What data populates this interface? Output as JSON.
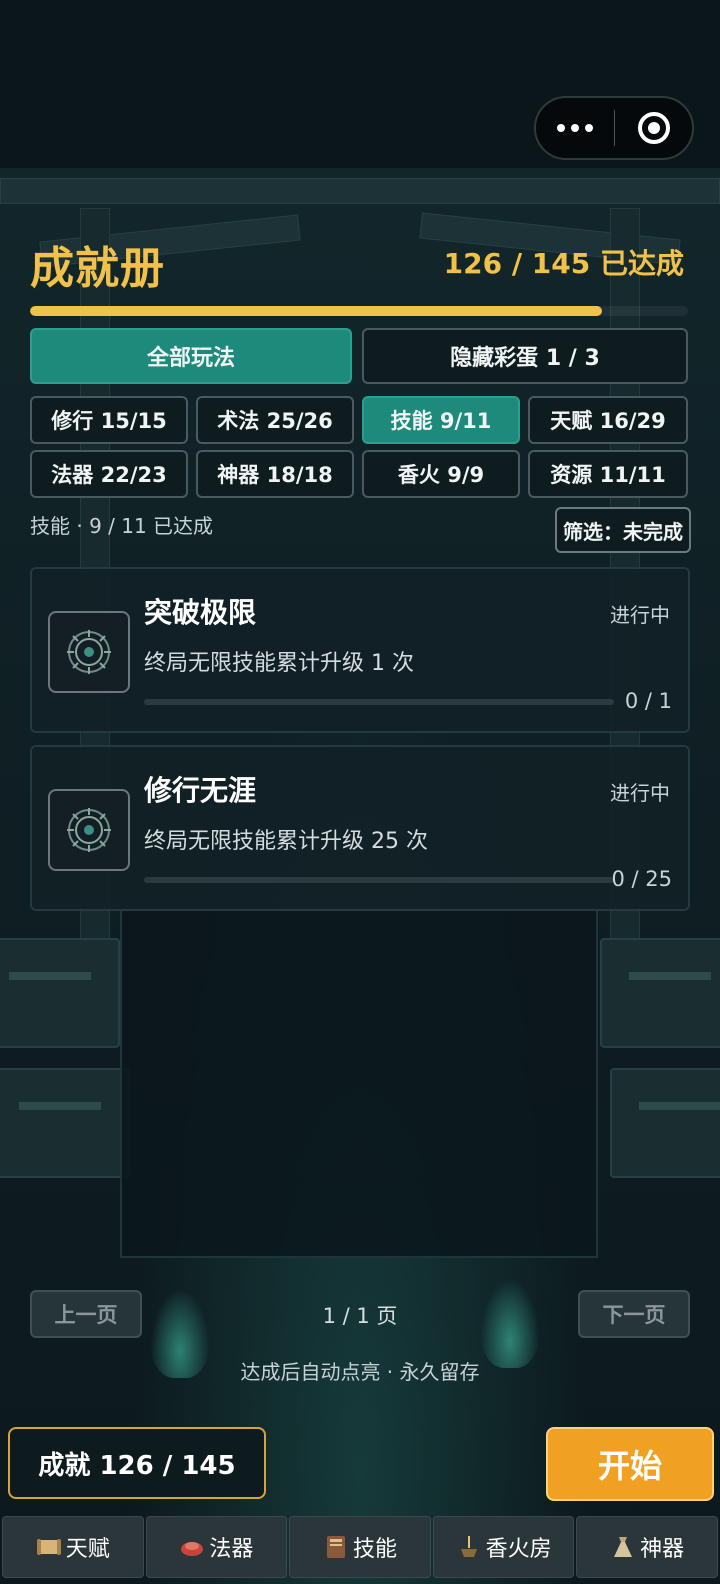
{
  "header": {
    "title": "成就册",
    "total": "126 / 145 已达成",
    "progress_fraction": 0.869
  },
  "tabs": [
    {
      "label": "全部玩法",
      "active": true
    },
    {
      "label": "隐藏彩蛋 1 / 3",
      "active": false
    }
  ],
  "categories": [
    {
      "label": "修行 15/15",
      "active": false
    },
    {
      "label": "术法 25/26",
      "active": false
    },
    {
      "label": "技能 9/11",
      "active": true
    },
    {
      "label": "天赋 16/29",
      "active": false
    },
    {
      "label": "法器 22/23",
      "active": false
    },
    {
      "label": "神器 18/18",
      "active": false
    },
    {
      "label": "香火 9/9",
      "active": false
    },
    {
      "label": "资源 11/11",
      "active": false
    }
  ],
  "summary": "技能 · 9 / 11 已达成",
  "filter_label": "筛选：未完成",
  "achievements": [
    {
      "name": "突破极限",
      "status": "进行中",
      "desc": "终局无限技能累计升级 1 次",
      "count": "0 / 1",
      "progress": 0
    },
    {
      "name": "修行无涯",
      "status": "进行中",
      "desc": "终局无限技能累计升级 25 次",
      "count": "0 / 25",
      "progress": 0
    }
  ],
  "pagination": {
    "prev_label": "上一页",
    "page_text": "1 / 1 页",
    "next_label": "下一页"
  },
  "note": "达成后自动点亮 · 永久留存",
  "footer": {
    "achievement_count": "成就 126 / 145",
    "start_label": "开始"
  },
  "nav": [
    {
      "label": "天赋",
      "icon": "scroll-icon"
    },
    {
      "label": "法器",
      "icon": "artifact-icon"
    },
    {
      "label": "技能",
      "icon": "book-icon"
    },
    {
      "label": "香火房",
      "icon": "incense-icon"
    },
    {
      "label": "神器",
      "icon": "bag-icon"
    }
  ],
  "colors": {
    "accent_gold": "#f2c14a",
    "active_teal": "#1e8a7b",
    "start_orange": "#f0a123"
  }
}
